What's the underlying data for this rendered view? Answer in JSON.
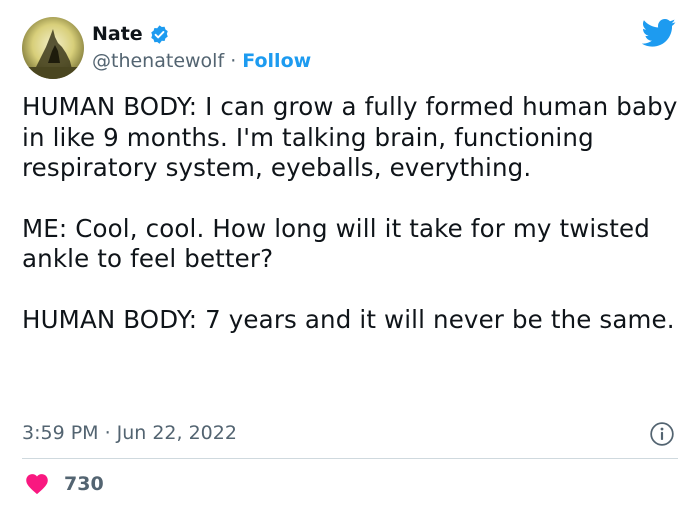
{
  "author": {
    "name": "Nate",
    "handle": "@thenatewolf",
    "separator": "·",
    "follow_label": "Follow"
  },
  "tweet": {
    "paragraphs": [
      "HUMAN BODY: I can grow a fully formed human baby in like 9 months. I'm talking brain, functioning respiratory system, eyeballs, everything.",
      "ME: Cool, cool. How long will it take for my twisted ankle to feel better?",
      "HUMAN BODY: 7 years and it will never be the same."
    ],
    "time": "3:59 PM",
    "separator": "·",
    "date": "Jun 22, 2022"
  },
  "engagement": {
    "likes": "730"
  },
  "icons": {
    "logo": "twitter-bird-icon",
    "verified": "verified-badge-icon",
    "info": "info-icon",
    "like": "heart-icon"
  },
  "colors": {
    "brand": "#1d9bf0",
    "heart": "#f91880",
    "secondary_text": "#536471"
  }
}
